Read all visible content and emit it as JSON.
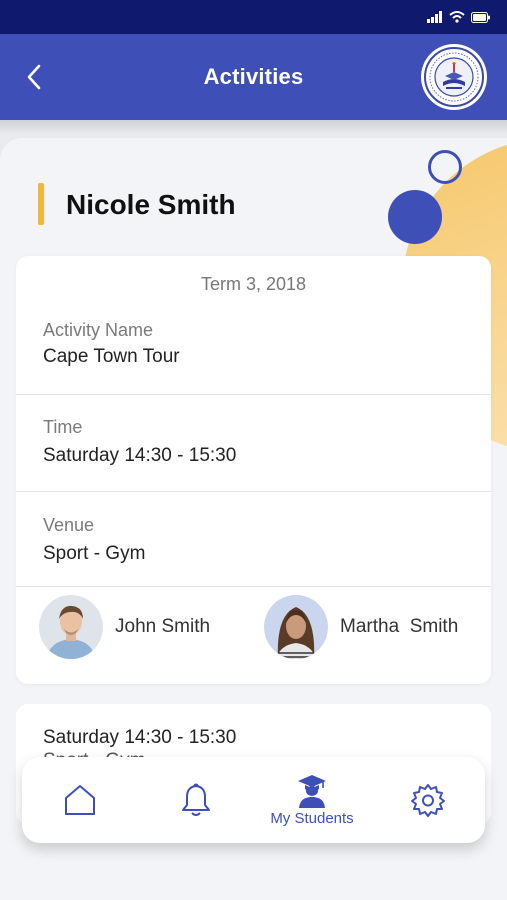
{
  "header": {
    "title": "Activities"
  },
  "student": {
    "name": "Nicole Smith"
  },
  "activity": {
    "term": "Term 3, 2018",
    "name_label": "Activity Name",
    "name_value": "Cape Town Tour",
    "time_label": "Time",
    "time_value": "Saturday 14:30 - 15:30",
    "venue_label": "Venue",
    "venue_value": "Sport - Gym",
    "teachers": [
      {
        "name": "John Smith"
      },
      {
        "name": "Martha  Smith"
      }
    ]
  },
  "next_activity": {
    "time_value": "Saturday 14:30 - 15:30",
    "venue_value": "Sport - Gym"
  },
  "nav": {
    "items": [
      {
        "icon": "home-icon"
      },
      {
        "icon": "bell-icon"
      },
      {
        "icon": "graduate-icon",
        "label": "My Students",
        "active": true
      },
      {
        "icon": "gear-icon"
      }
    ]
  },
  "colors": {
    "primary": "#3f4fb8",
    "status_bar": "#0f1a6e",
    "accent": "#f2b63c"
  }
}
